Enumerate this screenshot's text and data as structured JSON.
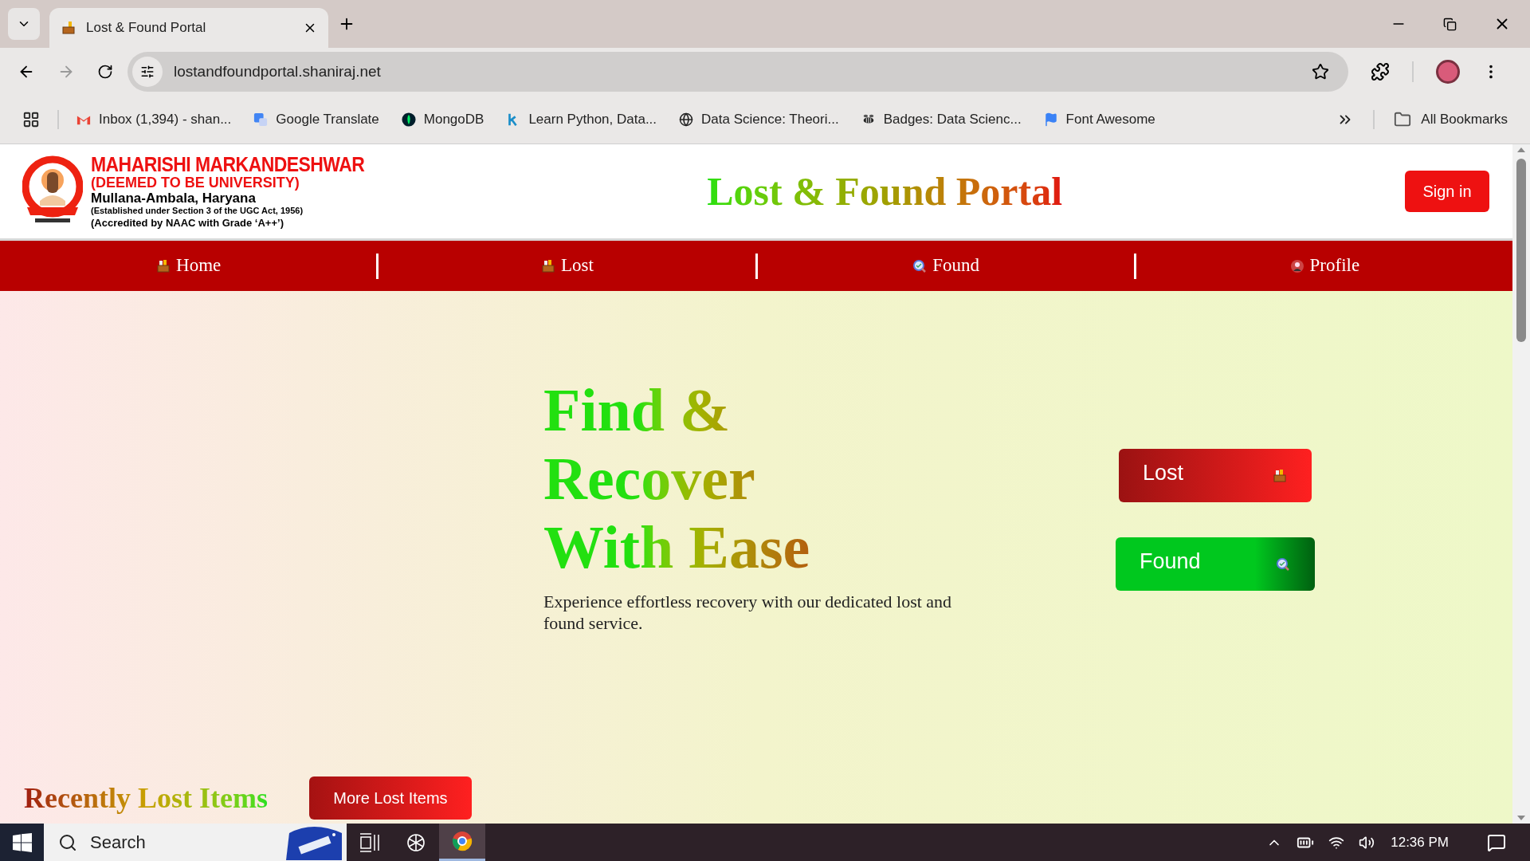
{
  "browser": {
    "tabs": [
      {
        "title": "Lost & Found Portal",
        "selected": true
      }
    ],
    "address": "lostandfoundportal.shaniraj.net",
    "bookmarks": [
      {
        "label": "Inbox (1,394) - shan...",
        "kind": "mail"
      },
      {
        "label": "Google Translate",
        "kind": "translate"
      },
      {
        "label": "MongoDB",
        "kind": "leaf"
      },
      {
        "label": "Learn Python, Data...",
        "kind": "k"
      },
      {
        "label": "Data Science: Theori...",
        "kind": "globe"
      },
      {
        "label": "Badges: Data Scienc...",
        "kind": "bee"
      },
      {
        "label": "Font Awesome",
        "kind": "flag"
      }
    ],
    "all_bookmarks": "All Bookmarks"
  },
  "header": {
    "university": [
      "MAHARISHI MARKANDESHWAR",
      "(DEEMED TO BE UNIVERSITY)",
      "Mullana-Ambala, Haryana",
      "(Established under Section 3 of the UGC Act, 1956)",
      "(Accredited by NAAC with Grade ‘A++’)"
    ],
    "title": "Lost & Found Portal",
    "sign_in": "Sign in"
  },
  "nav": [
    {
      "label": "Home",
      "kind": "home"
    },
    {
      "label": "Lost",
      "kind": "lost"
    },
    {
      "label": "Found",
      "kind": "found"
    },
    {
      "label": "Profile",
      "kind": "profile"
    }
  ],
  "hero": {
    "title": "Find & Recover With Ease",
    "subtitle": "Experience effortless recovery with our dedicated lost and found service.",
    "buttons": [
      {
        "label": "Lost",
        "kind": "lost"
      },
      {
        "label": "Found",
        "kind": "found"
      }
    ]
  },
  "recent": {
    "title": "Recently Lost Items",
    "button": "More Lost Items"
  },
  "taskbar": {
    "search_placeholder": "Search",
    "time": "12:36 PM"
  }
}
